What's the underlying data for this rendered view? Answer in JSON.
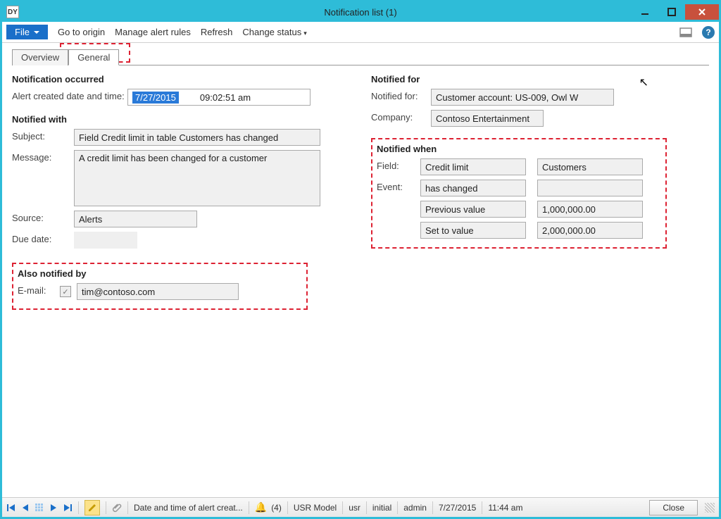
{
  "window": {
    "title": "Notification list (1)",
    "appicon_text": "DY"
  },
  "toolbar": {
    "file": "File",
    "goto": "Go to origin",
    "manage": "Manage alert rules",
    "refresh": "Refresh",
    "change": "Change status"
  },
  "tabs": {
    "overview": "Overview",
    "general": "General"
  },
  "sections": {
    "occurred": "Notification occurred",
    "with": "Notified with",
    "also": "Also notified by",
    "for": "Notified for",
    "when": "Notified when"
  },
  "labels": {
    "alert_dt": "Alert created date and time:",
    "subject": "Subject:",
    "message": "Message:",
    "source": "Source:",
    "due": "Due date:",
    "email": "E-mail:",
    "notifiedfor": "Notified for:",
    "company": "Company:",
    "field": "Field:",
    "event": "Event:",
    "prev": "Previous value",
    "setto": "Set to value"
  },
  "values": {
    "date": "7/27/2015",
    "time": "09:02:51 am",
    "subject": "Field Credit limit in table Customers has changed",
    "message": "A credit limit has been changed for a customer",
    "source": "Alerts",
    "email": "tim@contoso.com",
    "notifiedfor": "Customer account: US-009, Owl W",
    "company": "Contoso Entertainment",
    "field": "Credit limit",
    "table": "Customers",
    "event": "has changed",
    "prev": "1,000,000.00",
    "setto": "2,000,000.00",
    "email_checked": "✓"
  },
  "status": {
    "filter": "Date and time of alert creat...",
    "alert_count": "(4)",
    "model": "USR Model",
    "layer": "usr",
    "mode": "initial",
    "user": "admin",
    "date": "7/27/2015",
    "time": "11:44 am",
    "close": "Close"
  }
}
